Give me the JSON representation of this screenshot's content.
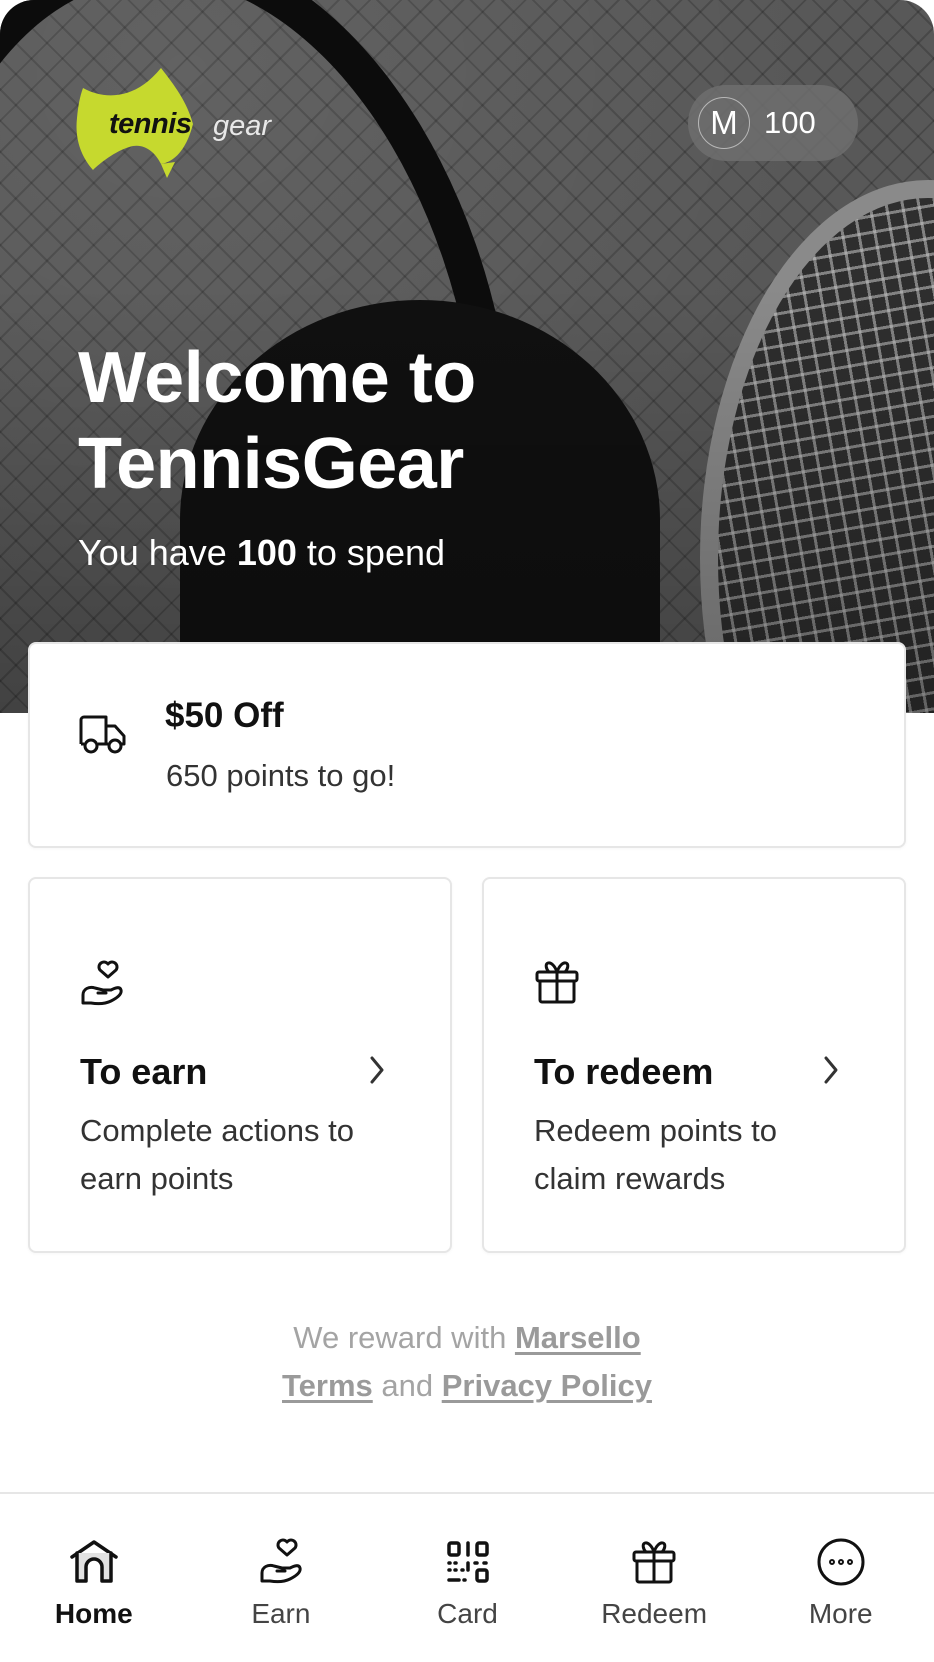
{
  "brand": {
    "logo_word_1": "tennis",
    "logo_word_2": "gear",
    "logo_color": "#c6d92e"
  },
  "header": {
    "avatar_initial": "M",
    "points_balance": "100"
  },
  "hero": {
    "title_line_1": "Welcome to",
    "title_line_2": "TennisGear",
    "spend_prefix": "You have ",
    "spend_points": "100",
    "spend_suffix": " to spend"
  },
  "offer": {
    "icon": "truck-icon",
    "title": "$50 Off",
    "subtitle": "650 points to go!"
  },
  "cards": [
    {
      "icon": "hand-heart-icon",
      "title": "To earn",
      "description": "Complete actions to earn points"
    },
    {
      "icon": "gift-icon",
      "title": "To redeem",
      "description": "Redeem points to claim rewards"
    }
  ],
  "footer": {
    "reward_prefix": "We reward with ",
    "reward_link": "Marsello",
    "terms_link": "Terms",
    "and_text": " and ",
    "privacy_link": "Privacy Policy"
  },
  "nav": {
    "active": "Home",
    "items": [
      {
        "label": "Home",
        "icon": "home-icon"
      },
      {
        "label": "Earn",
        "icon": "hand-heart-icon"
      },
      {
        "label": "Card",
        "icon": "qr-code-icon"
      },
      {
        "label": "Redeem",
        "icon": "gift-icon"
      },
      {
        "label": "More",
        "icon": "more-circle-icon"
      }
    ]
  }
}
